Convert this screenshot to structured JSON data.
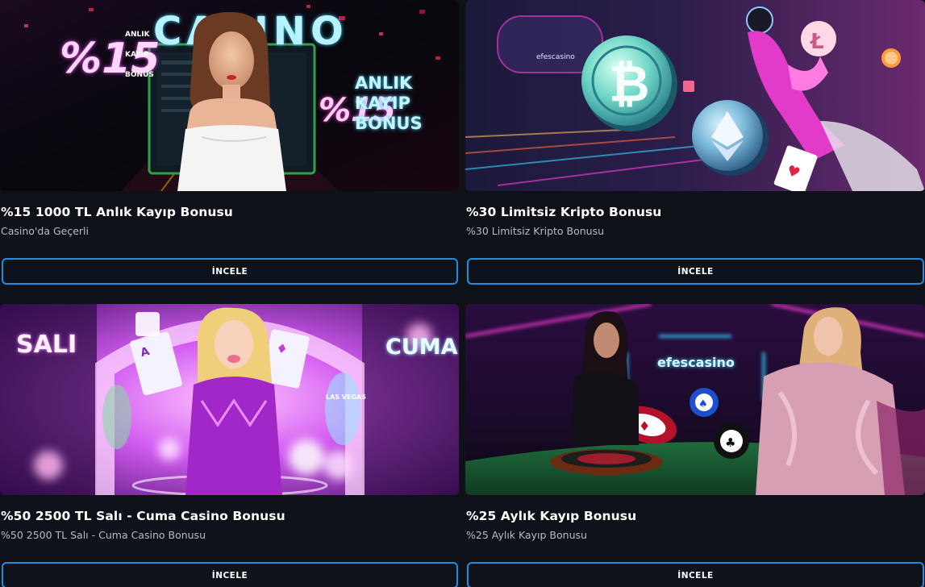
{
  "promotions": [
    {
      "title": "%15 1000 TL Anlık Kayıp Bonusu",
      "subtitle": "Casino'da Geçerli",
      "button_label": "İNCELE",
      "banner": {
        "neon_left": "%15",
        "neon_casino": "CASINO",
        "neon_right_big": "%15",
        "neon_right_lines": [
          "ANLIK",
          "KAYIP",
          "BONUS"
        ],
        "neon_small_lines": [
          "ANLIK",
          "KAYIP",
          "BONUS"
        ]
      }
    },
    {
      "title": "%30 Limitsiz Kripto Bonusu",
      "subtitle": "%30 Limitsiz Kripto Bonusu",
      "button_label": "İNCELE",
      "banner": {
        "logo_text": "efescasino"
      }
    },
    {
      "title": "%50 2500 TL Salı - Cuma Casino Bonusu",
      "subtitle": "%50 2500 TL Salı - Cuma Casino Bonusu",
      "button_label": "İNCELE",
      "banner": {
        "neon_left": "SALI",
        "neon_right": "CUMA",
        "sign_text": "LAS VEGAS"
      }
    },
    {
      "title": "%25 Aylık Kayıp Bonusu",
      "subtitle": "%25 Aylık Kayıp Bonusu",
      "button_label": "İNCELE",
      "banner": {
        "logo_text": "efescasino"
      }
    }
  ],
  "colors": {
    "background": "#0e1118",
    "button_border": "#1e8fe0",
    "subtitle_text": "#b7bcc7",
    "neon_pink": "#ff3ddb",
    "neon_cyan": "#36d6ff"
  }
}
